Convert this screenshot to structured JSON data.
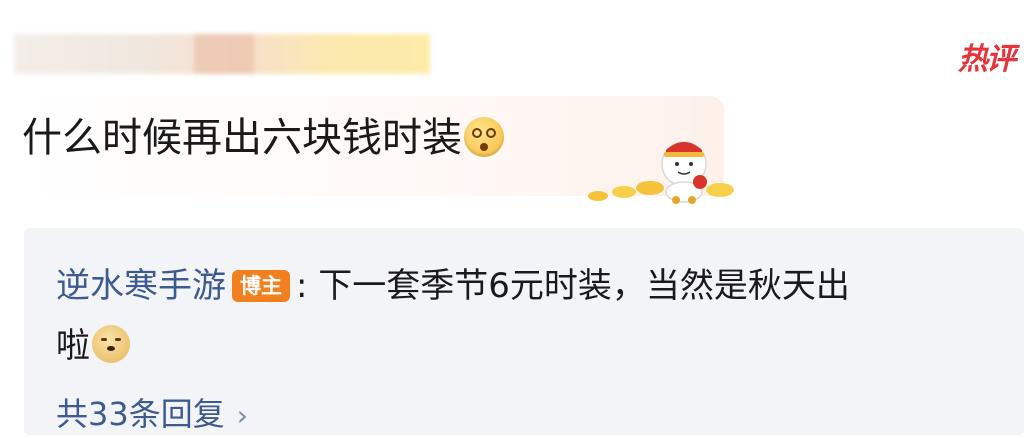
{
  "comment": {
    "text": "什么时候再出六块钱时装",
    "emoji_icon": "dizzy-face-emoji",
    "sticker_icon": "fortune-god-sticker",
    "hot_badge": "热评"
  },
  "reply": {
    "author": "逆水寒手游",
    "author_badge": "博主",
    "separator": ":",
    "text_line1": "下一套季节6元时装，当然是秋天出",
    "text_line2": "啦",
    "emoji_icon": "doge-emoji"
  },
  "reply_count_label": "共33条回复",
  "colors": {
    "link": "#3e5b8f",
    "badge_orange": "#f2801f",
    "hot_red": "#e5343b",
    "reply_bg": "#f3f4f7"
  }
}
